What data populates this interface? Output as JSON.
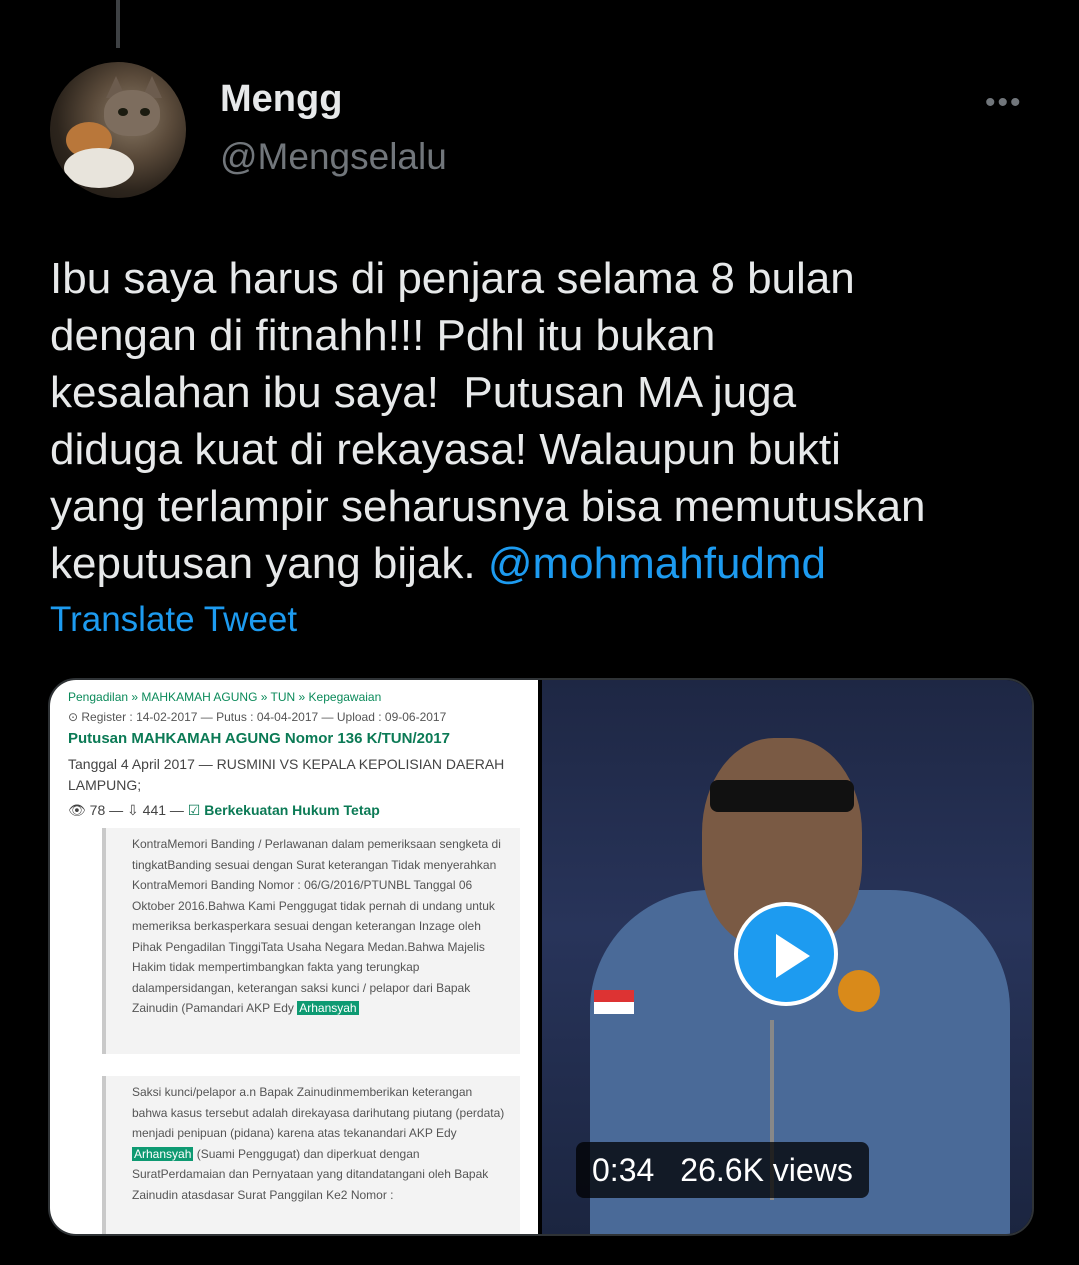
{
  "tweet": {
    "display_name": "Mengg",
    "handle": "@Mengselalu",
    "more_icon": "more-horizontal-icon",
    "text_lines": [
      "Ibu saya harus di penjara selama 8 bulan",
      "dengan di fitnahh!!! Pdhl itu bukan",
      "kesalahan ibu saya!  Putusan MA juga",
      "diduga kuat di rekayasa! Walaupun bukti",
      "yang terlampir seharusnya bisa memutuskan",
      "keputusan yang bijak. "
    ],
    "mention": "@mohmahfudmd",
    "translate_label": "Translate Tweet",
    "colors": {
      "accent": "#1d9bf0",
      "background": "#000000",
      "text": "#e7e9ea",
      "secondary": "#71767b"
    }
  },
  "media": {
    "document": {
      "breadcrumb": "Pengadilan » MAHKAMAH AGUNG » TUN » Kepegawaian",
      "meta": "Register : 14-02-2017 — Putus : 04-04-2017 — Upload : 09-06-2017",
      "title": "Putusan MAHKAMAH AGUNG Nomor 136 K/TUN/2017",
      "date_line": "Tanggal 4 April 2017 — RUSMINI VS KEPALA KEPOLISIAN DAERAH LAMPUNG;",
      "stats_views": "78",
      "stats_downloads": "441",
      "status": "Berkekuatan Hukum Tetap",
      "quote1_text": "KontraMemori Banding / Perlawanan dalam pemeriksaan sengketa di tingkatBanding sesuai dengan Surat keterangan Tidak menyerahkan KontraMemori Banding Nomor : 06/G/2016/PTUNBL Tanggal 06 Oktober 2016.Bahwa Kami Penggugat tidak pernah di undang untuk memeriksa berkasperkara sesuai dengan keterangan Inzage oleh Pihak Pengadilan TinggiTata Usaha Negara Medan.Bahwa Majelis Hakim tidak mempertimbangkan fakta yang terungkap dalampersidangan, keterangan saksi kunci / pelapor dari Bapak Zainudin (Pamandari AKP Edy ",
      "quote1_highlight": "Arhansyah",
      "quote2_text_a": "Saksi kunci/pelapor a.n Bapak Zainudinmemberikan keterangan bahwa kasus tersebut adalah direkayasa darihutang piutang (perdata) menjadi penipuan (pidana) karena atas tekanandari AKP Edy ",
      "quote2_highlight": "Arhansyah",
      "quote2_text_b": " (Suami Penggugat) dan diperkuat dengan SuratPerdamaian dan Pernyataan yang ditandatangani oleh Bapak Zainudin atasdasar Surat Panggilan Ke2 Nomor :"
    },
    "video": {
      "duration": "0:34",
      "views": "26.6K views",
      "play_icon": "play-icon"
    }
  }
}
